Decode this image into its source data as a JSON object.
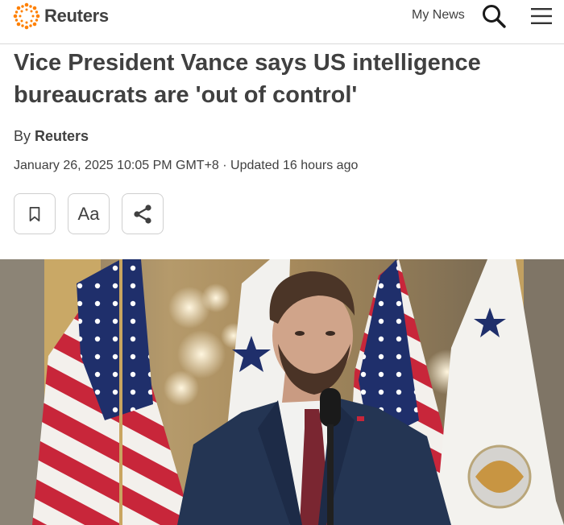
{
  "header": {
    "logo_text": "Reuters",
    "my_news_label": "My News",
    "search_icon": "search-icon",
    "menu_icon": "hamburger-menu-icon"
  },
  "article": {
    "headline": "Vice President Vance says US intelligence bureaucrats are 'out of control'",
    "byline_prefix": "By",
    "byline_author": "Reuters",
    "dateline": "January 26, 2025 10:05 PM GMT+8 · Updated 16 hours ago"
  },
  "actions": {
    "bookmark_icon": "bookmark-icon",
    "text_size_label": "Aa",
    "share_icon": "share-icon"
  },
  "colors": {
    "brand_orange": "#ff8000",
    "text": "#404040",
    "border": "#cfcfcf"
  }
}
